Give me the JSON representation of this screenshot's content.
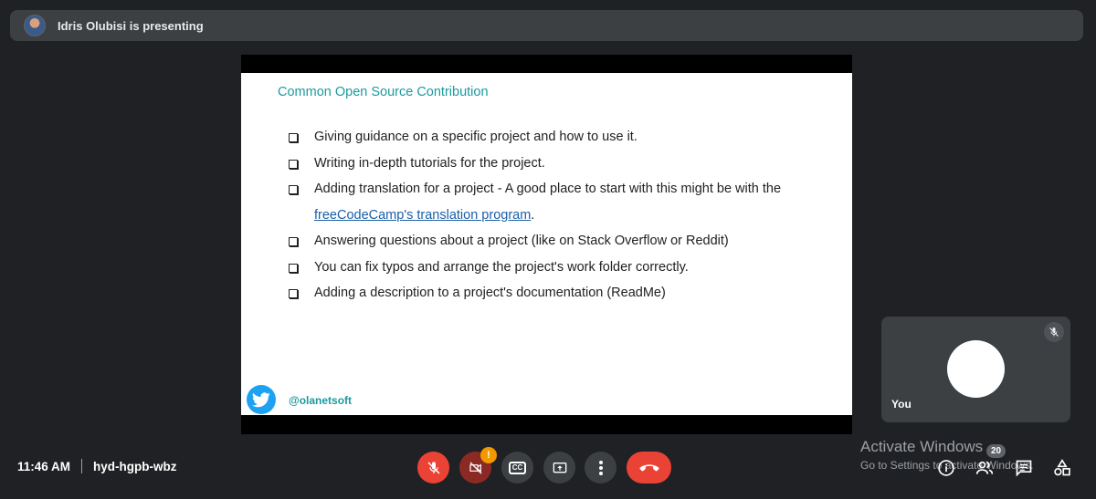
{
  "presenting_bar": {
    "text": "Idris Olubisi is presenting"
  },
  "slide": {
    "title": "Common Open Source Contribution",
    "bullets": [
      {
        "text": "Giving guidance on a specific project and how to use it."
      },
      {
        "text": "Writing in-depth tutorials for the project."
      },
      {
        "text": "Adding translation for a project - A good place to start with this might be with the",
        "link": "freeCodeCamp's translation program",
        "after": "."
      },
      {
        "text": "Answering questions about a project (like on Stack Overflow or Reddit)"
      },
      {
        "text": "You can fix typos and arrange the project's work folder correctly."
      },
      {
        "text": "Adding a description to a project's documentation (ReadMe)"
      }
    ],
    "twitter_handle": "@olanetsoft"
  },
  "self_tile": {
    "name": "You"
  },
  "meeting": {
    "time": "11:46 AM",
    "code": "hyd-hgpb-wbz"
  },
  "controls": {
    "camera_alert": "!",
    "participants_count": "20"
  },
  "watermark": {
    "line1": "Activate Windows",
    "line2": "Go to Settings to activate Windows."
  },
  "colors": {
    "slide_accent": "#1c9a9e",
    "end_call": "#ea4335",
    "alert": "#f29900"
  }
}
